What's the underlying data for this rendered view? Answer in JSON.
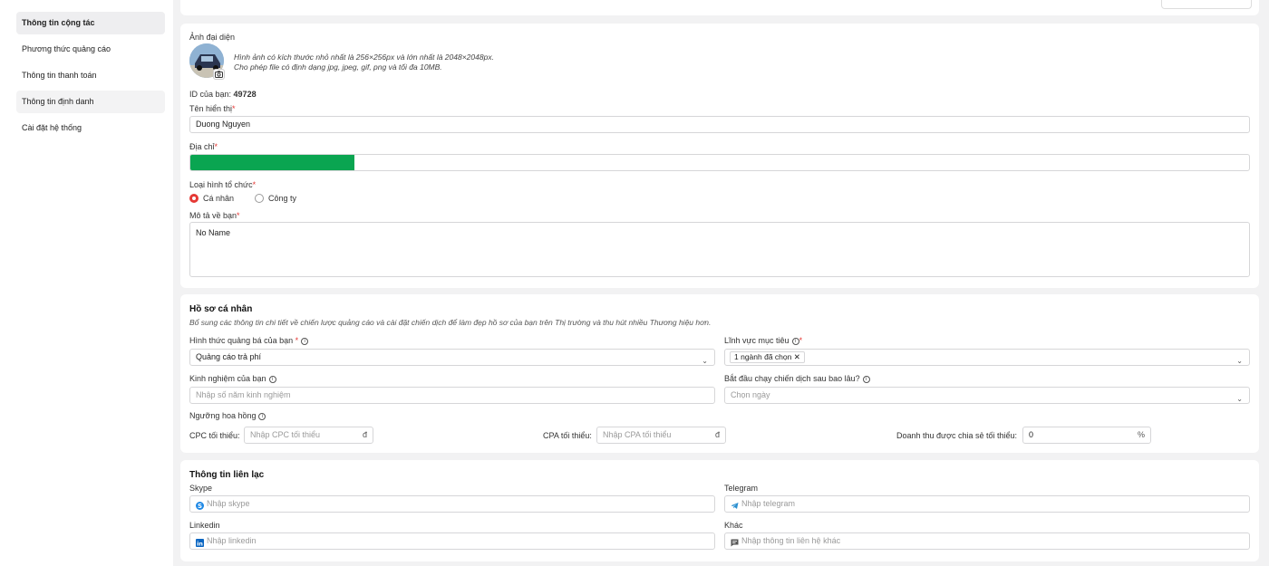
{
  "sidebar": {
    "items": [
      {
        "label": "Thông tin cộng tác"
      },
      {
        "label": "Phương thức quảng cáo"
      },
      {
        "label": "Thông tin thanh toán"
      },
      {
        "label": "Thông tin định danh"
      },
      {
        "label": "Cài đặt hệ thống"
      }
    ]
  },
  "profile": {
    "avatar_label": "Ảnh đại diện",
    "avatar_hint_1": "Hình ảnh có kích thước nhỏ nhất là 256×256px và lớn nhất là 2048×2048px.",
    "avatar_hint_2": "Cho phép file có định dạng jpg, jpeg, gif, png và tối đa 10MB.",
    "id_label": "ID của bạn:",
    "id_value": "49728",
    "display_name_label": "Tên hiển thị",
    "display_name_value": "Duong Nguyen",
    "address_label": "Địa chỉ",
    "address_progress_percent": 15.5,
    "org_type_label": "Loại hình tổ chức",
    "org_type_options": [
      "Cá nhân",
      "Công ty"
    ],
    "org_type_selected": "Cá nhân",
    "about_label": "Mô tả về bạn",
    "about_value": "No Name",
    "required_mark": "*"
  },
  "personal": {
    "title": "Hồ sơ cá nhân",
    "subtitle": "Bổ sung các thông tin chi tiết về chiến lược quảng cáo và cài đặt chiến dịch để làm đẹp hồ sơ của bạn trên Thị trường và thu hút nhiều Thương hiệu hơn.",
    "promo_label": "Hình thức quảng bá của bạn",
    "promo_value": "Quảng cáo trả phí",
    "field_label": "Lĩnh vực mục tiêu",
    "field_tag": "1 ngành đã chọn",
    "exp_label": "Kinh nghiệm của bạn",
    "exp_placeholder": "Nhập số năm kinh nghiệm",
    "start_label": "Bắt đầu chạy chiến dịch sau bao lâu?",
    "start_placeholder": "Chọn ngày",
    "threshold_label": "Ngưỡng hoa hồng",
    "cpc_label": "CPC tối thiểu:",
    "cpc_placeholder": "Nhập CPC tối thiểu",
    "cpc_suffix": "đ",
    "cpa_label": "CPA tối thiểu:",
    "cpa_placeholder": "Nhập CPA tối thiểu",
    "cpa_suffix": "đ",
    "rev_label": "Doanh thu được chia sẻ tối thiểu:",
    "rev_value": "0",
    "rev_suffix": "%"
  },
  "contact": {
    "title": "Thông tin liên lạc",
    "skype_label": "Skype",
    "skype_placeholder": "Nhập skype",
    "telegram_label": "Telegram",
    "telegram_placeholder": "Nhập telegram",
    "linkedin_label": "Linkedin",
    "linkedin_placeholder": "Nhập linkedin",
    "other_label": "Khác",
    "other_placeholder": "Nhập thông tin liên hệ khác"
  },
  "colors": {
    "accent": "#e53935",
    "progress": "#0aa551",
    "skype": "#1e88e5",
    "linkedin": "#0a66c2"
  }
}
